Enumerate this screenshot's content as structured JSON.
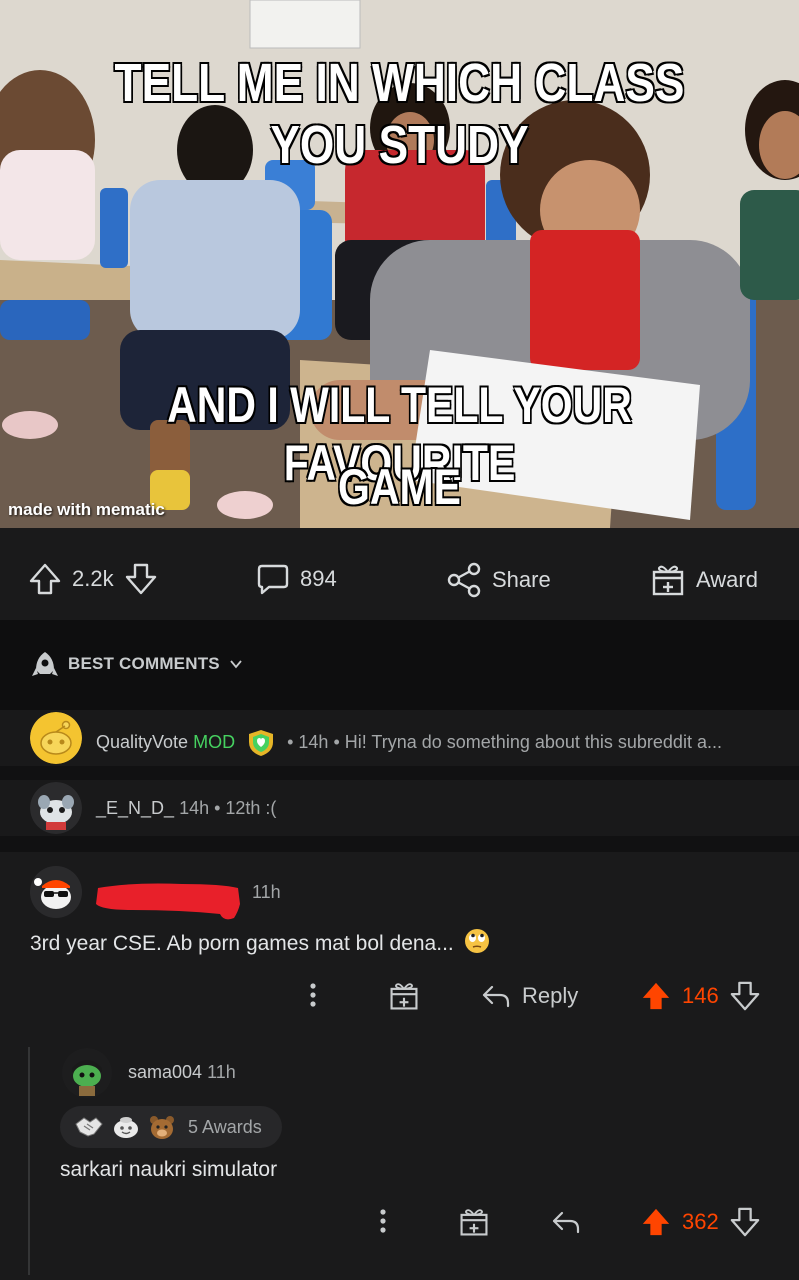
{
  "meme": {
    "top_caption": "TELL ME IN WHICH CLASS YOU STUDY",
    "middle_caption": "AND I WILL TELL YOUR FAVOURITE",
    "bottom_caption": "GAME",
    "watermark": "made with mematic"
  },
  "post_actions": {
    "votes": "2.2k",
    "comments": "894",
    "share_label": "Share",
    "award_label": "Award"
  },
  "sort": {
    "label": "BEST COMMENTS"
  },
  "collapsed_comments": [
    {
      "username": "QualityVote",
      "flair": "MOD",
      "meta": "• 14h • Hi! Tryna do something about this subreddit a..."
    },
    {
      "username": "_E_N_D_",
      "meta": "14h • 12th :("
    }
  ],
  "comment": {
    "time": "11h",
    "body": "3rd year CSE. Ab porn games mat bol dena...",
    "reply_label": "Reply",
    "score": "146"
  },
  "reply": {
    "username": "sama004",
    "time": "11h",
    "awards_label": "5 Awards",
    "body": "sarkari naukri simulator",
    "score": "362"
  },
  "colors": {
    "background": "#111112",
    "surface": "#1a1a1b",
    "upvote_active": "#ff4500",
    "mod_green": "#46d160",
    "text": "#d7dadc"
  }
}
